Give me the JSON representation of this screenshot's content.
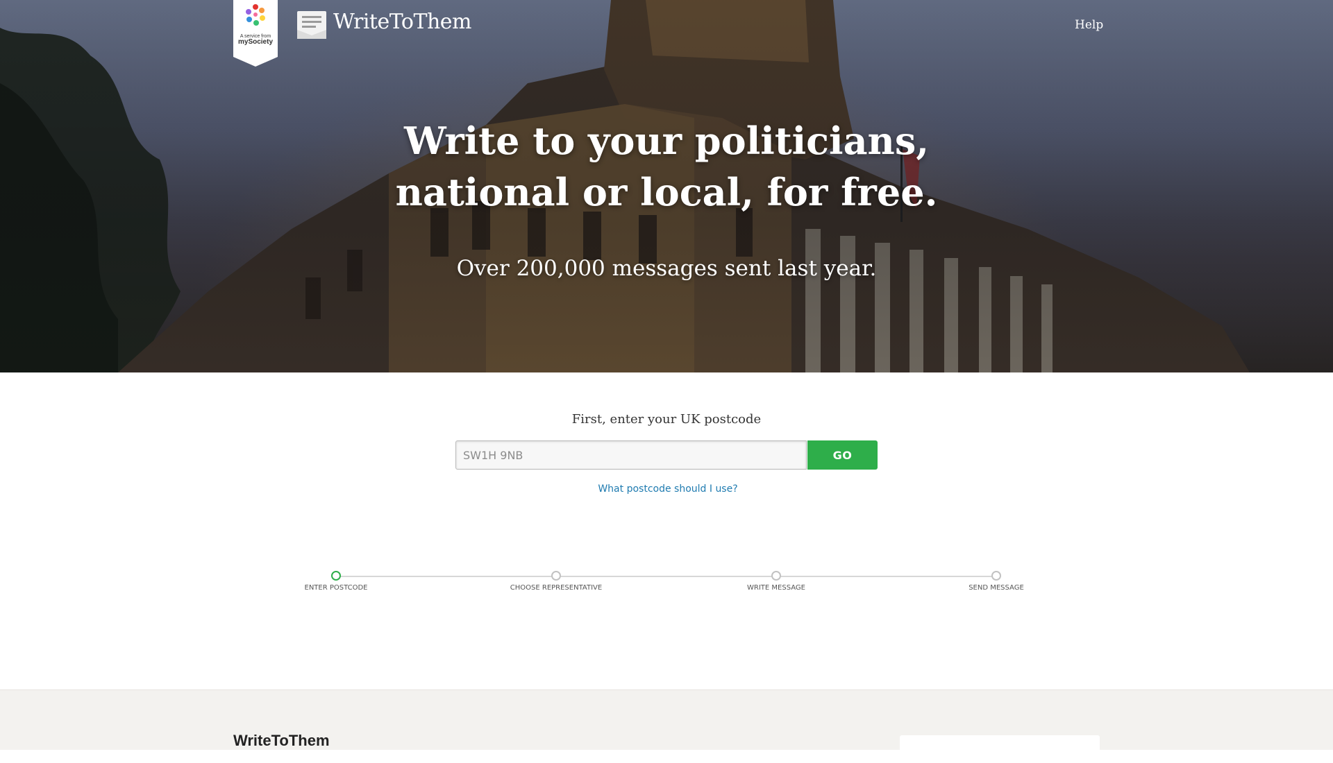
{
  "badge": {
    "line1": "A service from",
    "line2": "mySociety"
  },
  "header": {
    "logo_text": "WriteToThem",
    "help_label": "Help"
  },
  "hero": {
    "headline": "Write to your politicians, national or local, for free.",
    "subline": "Over 200,000 messages sent last year."
  },
  "form": {
    "label": "First, enter your UK postcode",
    "placeholder": "SW1H 9NB",
    "value": "",
    "go_label": "GO",
    "help_link": "What postcode should I use?"
  },
  "steps": [
    {
      "label": "Enter postcode",
      "active": true
    },
    {
      "label": "Choose representative",
      "active": false
    },
    {
      "label": "Write message",
      "active": false
    },
    {
      "label": "Send message",
      "active": false
    }
  ],
  "footer": {
    "title": "WriteToThem"
  },
  "colors": {
    "accent_green": "#2eae4a",
    "link_blue": "#1f7bb0",
    "footer_bg": "#f3f2ef"
  }
}
